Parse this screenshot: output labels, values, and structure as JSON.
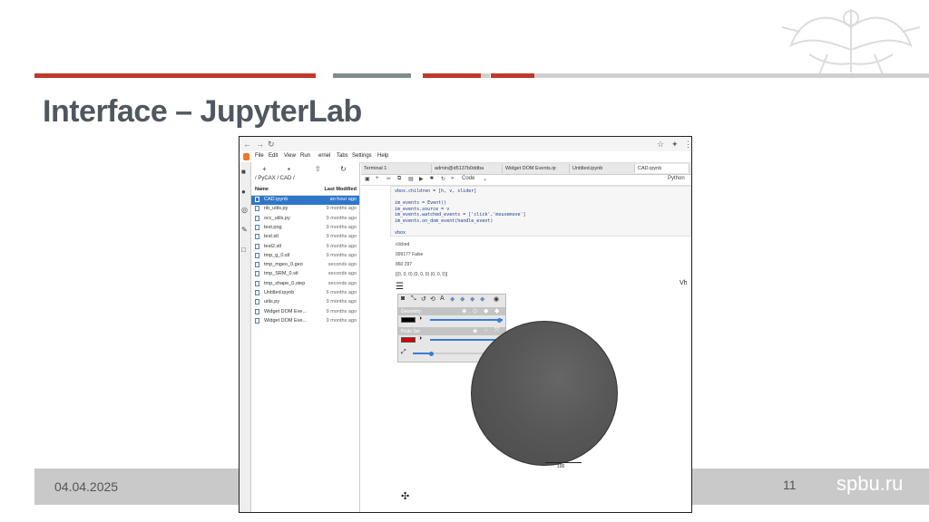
{
  "slide": {
    "title": "Interface – JupyterLab",
    "date": "04.04.2025",
    "page_number": "11",
    "site": "spbu.ru"
  },
  "colors": {
    "band_red": "#c0392b",
    "band_gray": "#7f8c8d",
    "footer_gray": "#c9c9c9",
    "title_gray": "#4f5760",
    "jupyter_orange": "#f37726",
    "selection_blue": "#2f76c9"
  },
  "jupyter": {
    "menu": [
      "File",
      "Edit",
      "View",
      "Run",
      "ernel",
      "Tabs",
      "Settings",
      "Help"
    ],
    "breadcrumb": "/ PyCAX / CAD /",
    "file_header": {
      "name": "Name",
      "modified": "Last Modified"
    },
    "files": [
      {
        "name": "CAD.ipynb",
        "modified": "an hour ago",
        "selected": true,
        "icon": "notebook-icon"
      },
      {
        "name": "nb_utils.py",
        "modified": "9 months ago",
        "icon": "python-file-icon"
      },
      {
        "name": "occ_utils.py",
        "modified": "9 months ago",
        "icon": "python-file-icon"
      },
      {
        "name": "test.png",
        "modified": "9 months ago",
        "icon": "image-file-icon"
      },
      {
        "name": "test.stl",
        "modified": "9 months ago",
        "icon": "file-icon"
      },
      {
        "name": "test2.stl",
        "modified": "9 months ago",
        "icon": "file-icon"
      },
      {
        "name": "tmp_g_0.stl",
        "modified": "9 months ago",
        "icon": "file-icon"
      },
      {
        "name": "tmp_mgeo_0.geo",
        "modified": "seconds ago",
        "icon": "file-icon"
      },
      {
        "name": "tmp_SRM_0.stl",
        "modified": "seconds ago",
        "icon": "file-icon"
      },
      {
        "name": "tmp_shape_0.step",
        "modified": "seconds ago",
        "icon": "file-icon"
      },
      {
        "name": "Untitled.ipynb",
        "modified": "6 months ago",
        "icon": "notebook-icon"
      },
      {
        "name": "utils.py",
        "modified": "9 months ago",
        "icon": "python-file-icon"
      },
      {
        "name": "Widget DOM Eve...",
        "modified": "9 months ago",
        "icon": "notebook-icon"
      },
      {
        "name": "Widget DOM Eve...",
        "modified": "9 months ago",
        "icon": "file-icon"
      }
    ],
    "tabs": [
      {
        "label": "Terminal 1"
      },
      {
        "label": "admin@d5137b0ddba"
      },
      {
        "label": "Widget DOM Events.ip"
      },
      {
        "label": "Untitled.ipynb"
      },
      {
        "label": "CAD.ipynb",
        "active": true
      }
    ],
    "cell_type": "Code",
    "kernel": "Python",
    "code_lines": [
      "vbox.children = [h, v, slider]",
      "",
      "im_events = Event()",
      "im_events.source = v",
      "im_events.watched_events = ['click','mousemove']",
      "im_events.on_dom_event(handle_event)",
      "",
      "vbox"
    ],
    "output_lines": [
      "clicked",
      "999177 False",
      "860 297",
      "[(0, 0, 0) (0, 0, 0) (0, 0, 0)]"
    ],
    "viewer": {
      "section_geometry": "Geometry",
      "section_points": "Proto Set",
      "geometry_color": "#000000",
      "points_color": "#cc0000",
      "slider_fraction": 0.95,
      "scale_label": "100"
    }
  }
}
